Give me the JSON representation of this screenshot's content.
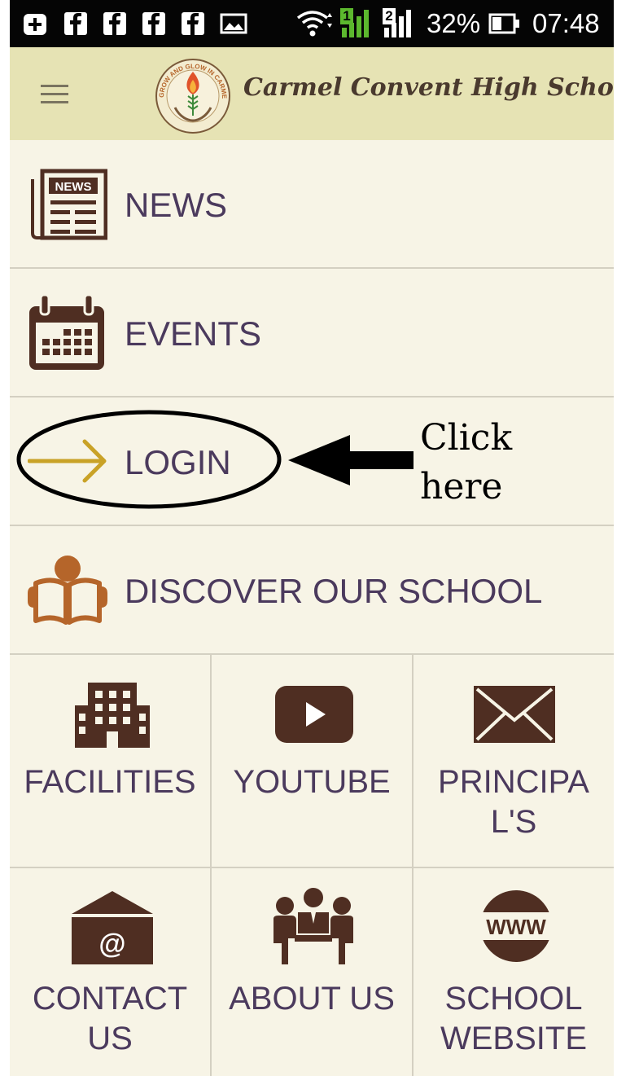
{
  "status_bar": {
    "battery": "32%",
    "time": "07:48",
    "notification_icons": [
      "plus-box-icon",
      "facebook-icon",
      "facebook-icon",
      "facebook-icon",
      "facebook-icon",
      "image-icon"
    ],
    "sim_labels": [
      "1",
      "2"
    ]
  },
  "app_bar": {
    "title": "Carmel Convent High School",
    "logo_motto": "GROW AND GLOW IN CARMEL"
  },
  "menu": {
    "items": [
      {
        "label": "NEWS",
        "icon": "newspaper-icon",
        "badge": "NEWS"
      },
      {
        "label": "EVENTS",
        "icon": "calendar-icon"
      },
      {
        "label": "LOGIN",
        "icon": "arrow-right-icon"
      },
      {
        "label": "DISCOVER OUR SCHOOL",
        "icon": "reading-book-icon"
      }
    ]
  },
  "grid": {
    "tiles": [
      {
        "label": "FACILITIES",
        "icon": "building-icon"
      },
      {
        "label": "YOUTUBE",
        "icon": "youtube-play-icon"
      },
      {
        "label": "PRINCIPAL'S",
        "icon": "envelope-icon"
      },
      {
        "label": "CONTACT US",
        "icon": "contact-envelope-icon",
        "symbol": "@"
      },
      {
        "label": "ABOUT US",
        "icon": "meeting-people-icon"
      },
      {
        "label": "SCHOOL WEBSITE",
        "icon": "www-globe-icon",
        "symbol": "WWW"
      }
    ]
  },
  "annotation": {
    "line1": "Click",
    "line2": "here"
  },
  "colors": {
    "background": "#f7f4e6",
    "app_bar": "#e6e3b4",
    "text": "#4b3a5d",
    "icon_brown": "#4f2e22",
    "icon_orange": "#b5652a",
    "login_arrow": "#c9a227",
    "divider": "#d4d0c2"
  }
}
